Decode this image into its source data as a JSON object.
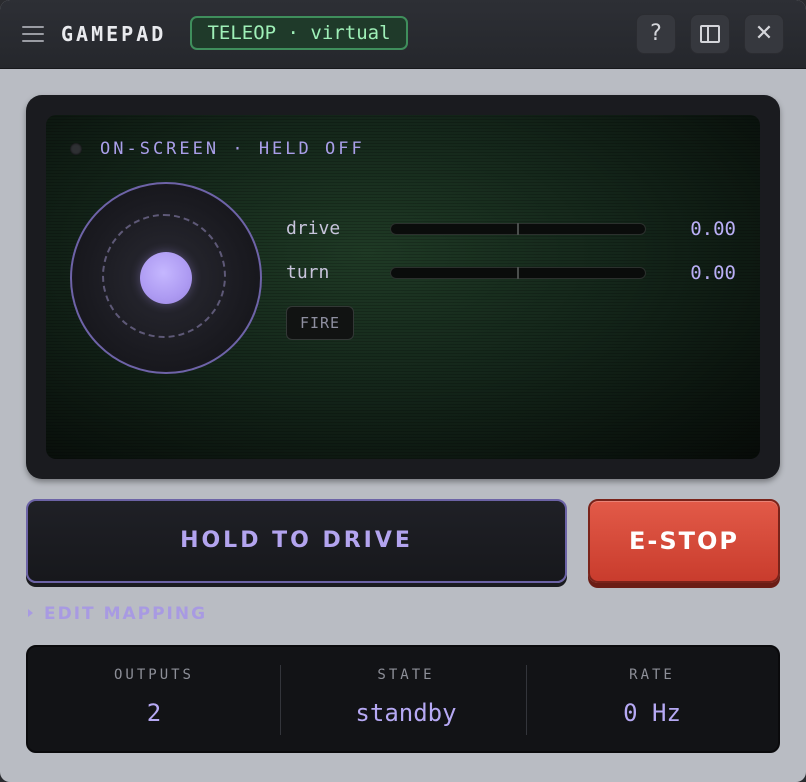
{
  "titlebar": {
    "title": "GAMEPAD",
    "mode_badge": "TELEOP · virtual",
    "help_glyph": "?",
    "close_glyph": "✕"
  },
  "screen": {
    "status_text": "ON-SCREEN · HELD OFF",
    "axes": [
      {
        "label": "drive",
        "value": "0.00"
      },
      {
        "label": "turn",
        "value": "0.00"
      }
    ],
    "fire_label": "FIRE"
  },
  "actions": {
    "hold_label": "HOLD TO DRIVE",
    "estop_label": "E-STOP"
  },
  "mapping": {
    "toggle_label": "EDIT MAPPING"
  },
  "stats": [
    {
      "label": "OUTPUTS",
      "value": "2"
    },
    {
      "label": "STATE",
      "value": "standby"
    },
    {
      "label": "RATE",
      "value": "0 Hz"
    }
  ],
  "colors": {
    "accent": "#b3a4ef",
    "estop": "#d84a3a",
    "badge_green": "#9ff0b8"
  },
  "icons": {
    "menu": "hamburger-menu-icon",
    "help": "question-mark-icon",
    "split": "split-panel-icon",
    "close": "close-icon"
  }
}
